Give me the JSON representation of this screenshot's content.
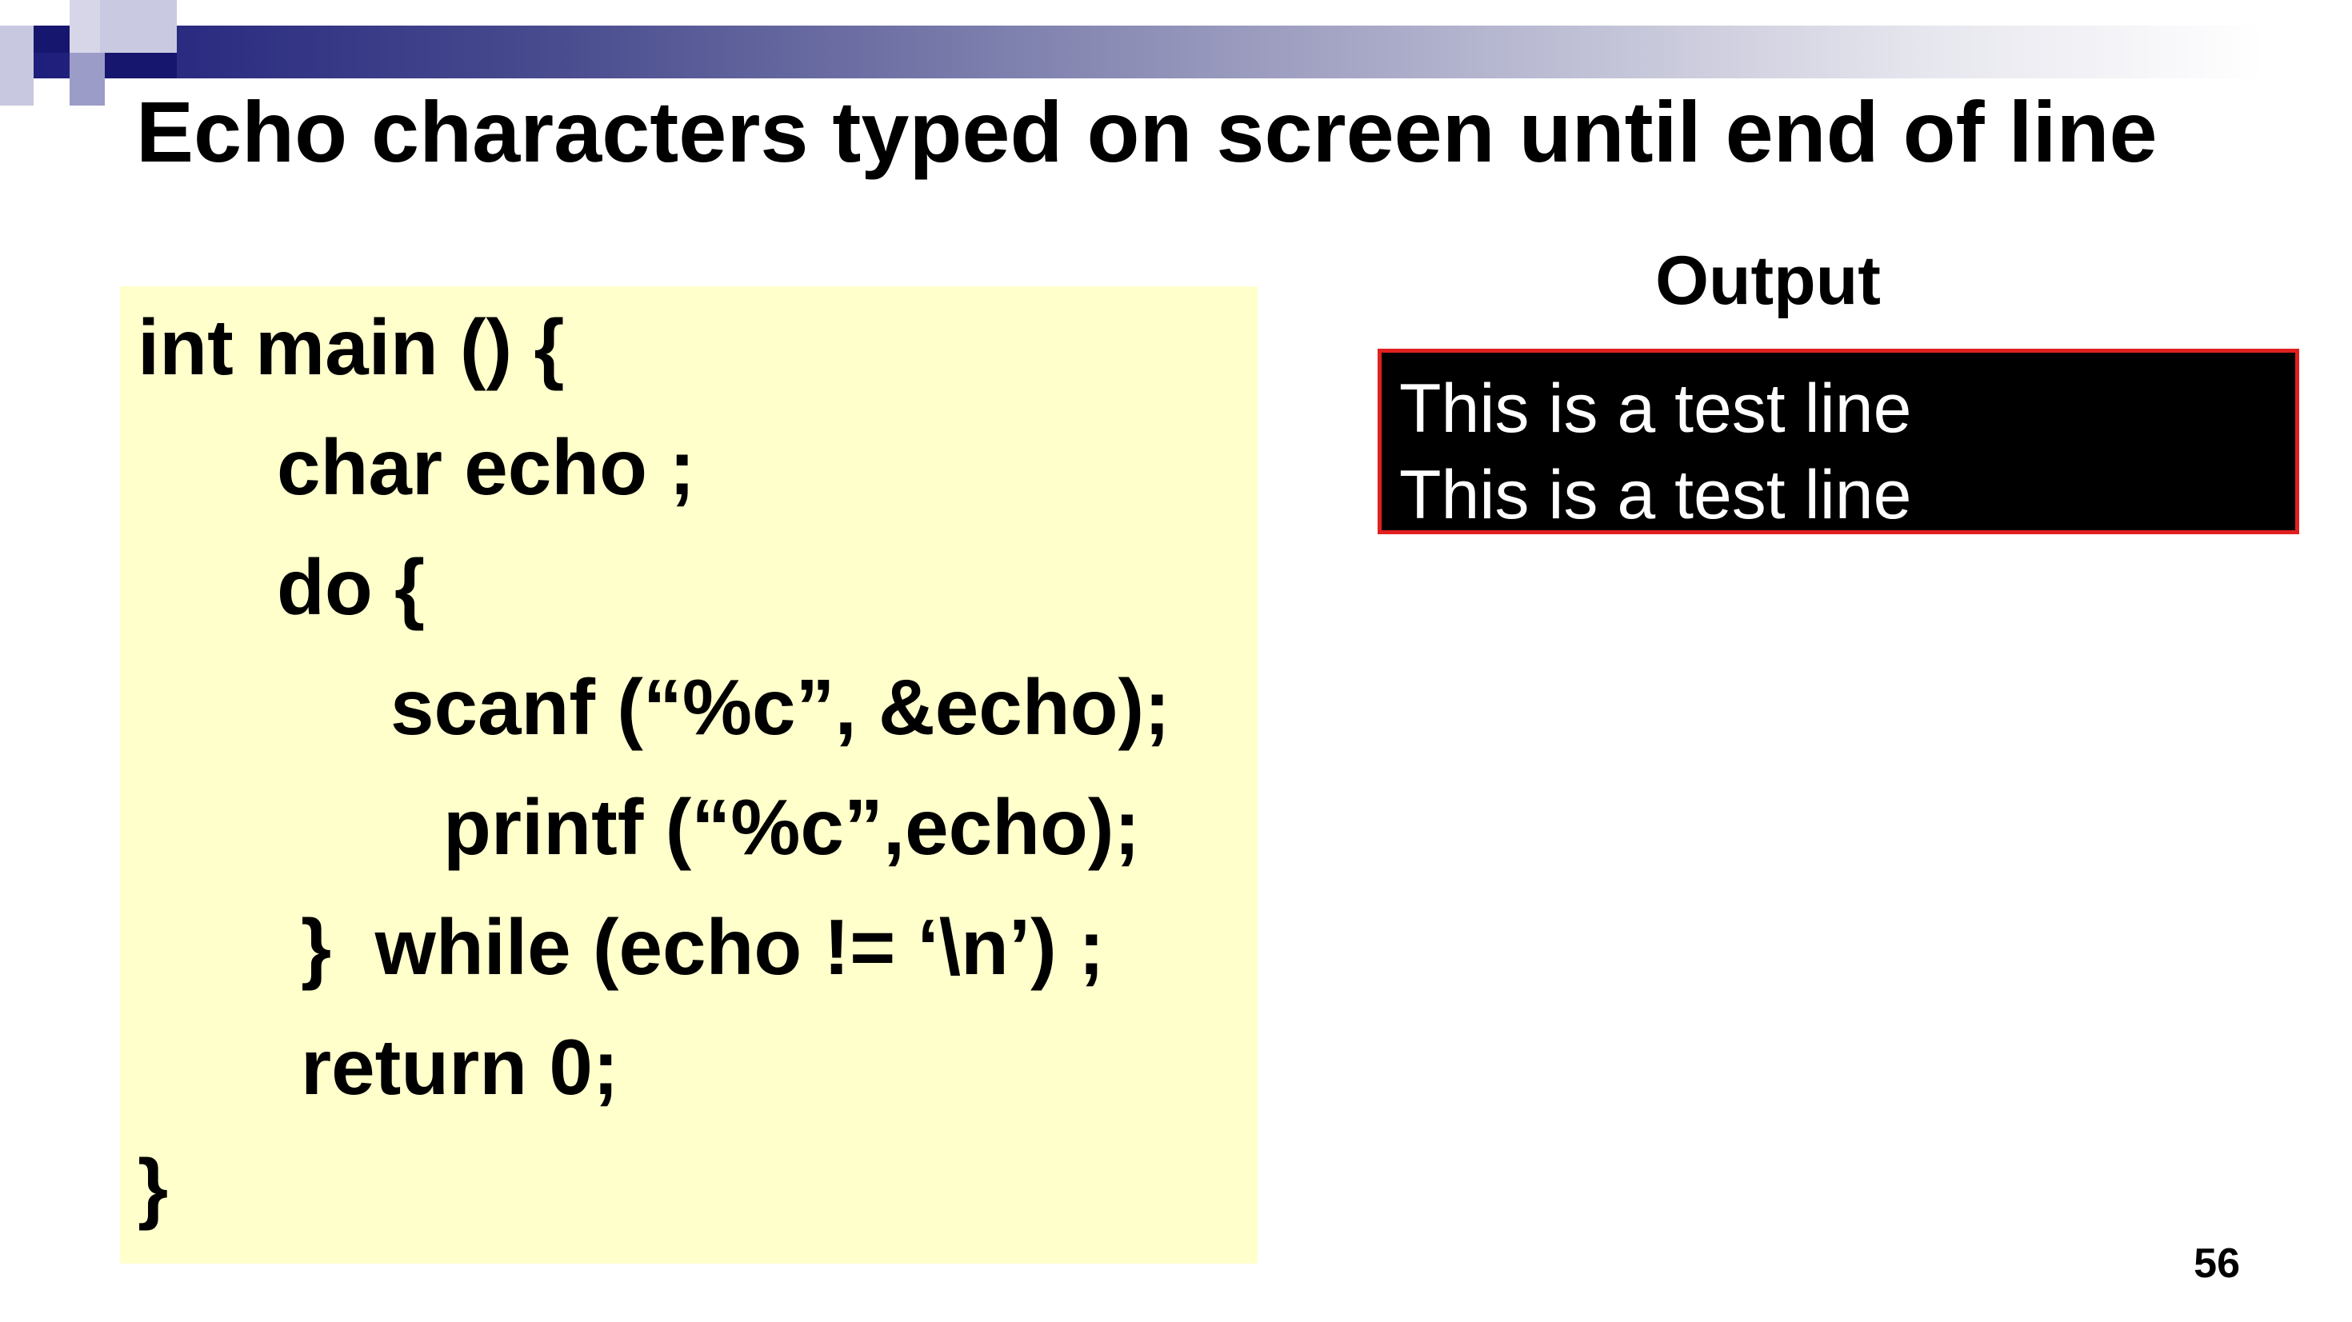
{
  "slide": {
    "title": "Echo characters typed on screen until end of line",
    "page_number": "56"
  },
  "code": {
    "lines": [
      "int main () {",
      "char echo ;",
      "do {",
      "scanf (“%c”, &echo);",
      "printf (“%c”,echo);",
      "}  while (echo != ‘\\n’) ;",
      "return 0;",
      "}"
    ]
  },
  "output": {
    "heading": "Output",
    "lines": [
      "This is a test line",
      "This is a test line"
    ]
  },
  "colors": {
    "code_background": "#ffffcc",
    "output_background": "#000000",
    "output_border": "#e02020",
    "output_text": "#ffffff",
    "header_band_dark": "#1b1b7a"
  }
}
